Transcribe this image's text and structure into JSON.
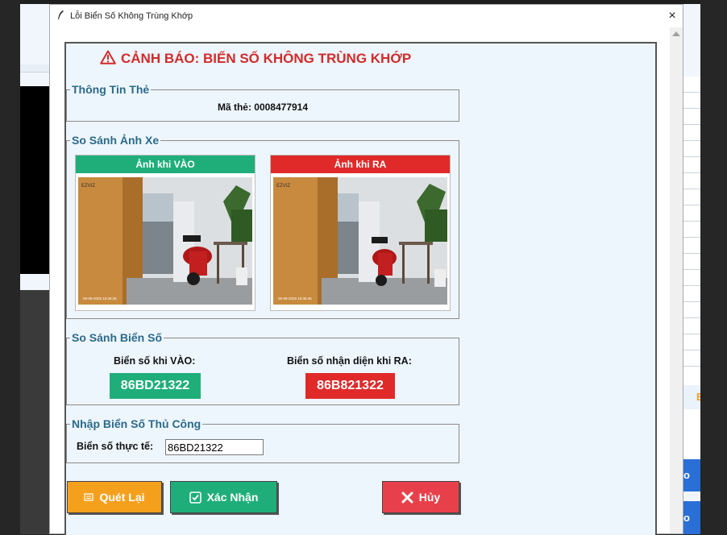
{
  "window": {
    "title": "Lỗi Biển Số Không Trùng Khớp",
    "close_glyph": "×"
  },
  "warning": {
    "text": "CẢNH BÁO: BIỂN SỐ KHÔNG TRÙNG KHỚP",
    "color": "#d12b2b"
  },
  "card_info": {
    "legend": "Thông Tin Thẻ",
    "card_id_text": "Mã thẻ: 0008477914"
  },
  "image_compare": {
    "legend": "So Sánh Ảnh Xe",
    "entry": {
      "header": "Ảnh khi VÀO",
      "color": "#1fae7a",
      "timestamp": "06-09-2025 16:36:36",
      "watermark": "EZVIZ"
    },
    "exit": {
      "header": "Ảnh khi RA",
      "color": "#e02a2a",
      "timestamp": "06-09-2025 16:36:46",
      "watermark": "EZVIZ"
    }
  },
  "plate_compare": {
    "legend": "So Sánh Biển Số",
    "entry_label": "Biển số khi VÀO:",
    "entry_plate": "86BD21322",
    "exit_label": "Biển số nhận diện khi RA:",
    "exit_plate": "86B821322",
    "entry_color": "#1fae7a",
    "exit_color": "#e02a2a"
  },
  "manual_entry": {
    "legend": "Nhập Biển Số Thủ Công",
    "field_label": "Biển số thực tế:",
    "field_value": "86BD21322"
  },
  "buttons": {
    "rescan": {
      "label": "Quét Lại",
      "icon": "scan-icon",
      "color": "#f5a01d"
    },
    "confirm": {
      "label": "Xác Nhận",
      "icon": "checkbox-icon",
      "color": "#1fae7a"
    },
    "cancel": {
      "label": "Hủy",
      "icon": "x-icon",
      "color": "#e8404a"
    }
  },
  "background_app": {
    "orange_letter": "E",
    "button_glyph": "o"
  }
}
